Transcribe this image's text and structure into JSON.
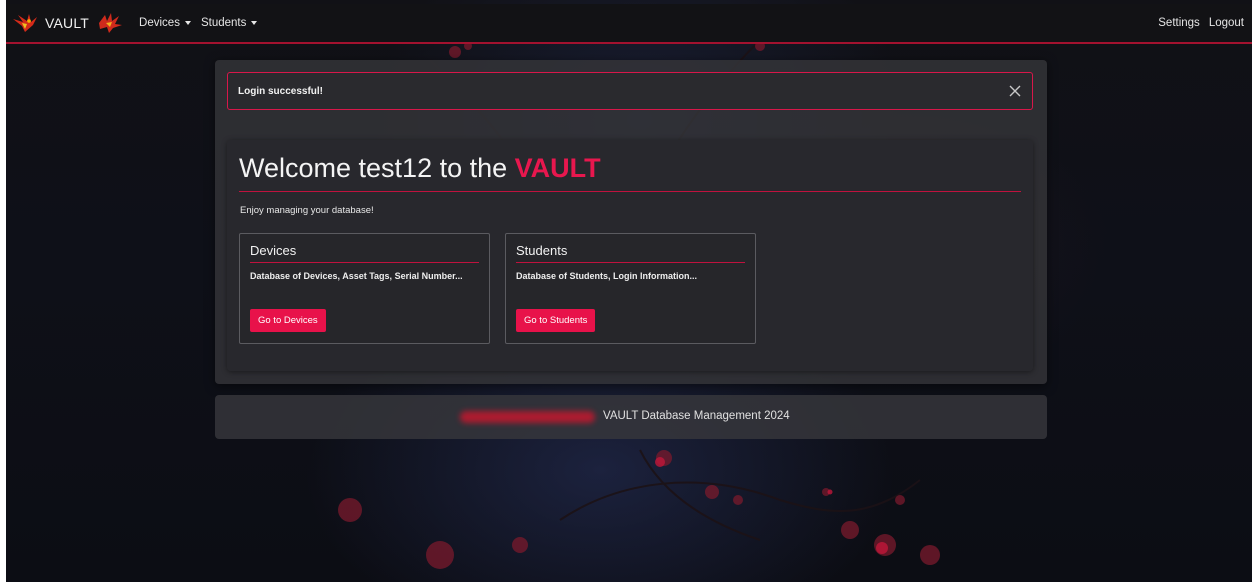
{
  "navbar": {
    "brand": "VAULT",
    "menu": [
      {
        "label": "Devices"
      },
      {
        "label": "Students"
      }
    ],
    "right_links": [
      {
        "label": "Settings"
      },
      {
        "label": "Logout"
      }
    ]
  },
  "alert": {
    "message": "Login successful!"
  },
  "welcome": {
    "title_prefix": "Welcome test12 to the",
    "title_highlight": "VAULT",
    "subtitle": "Enjoy managing your database!"
  },
  "cards": [
    {
      "title": "Devices",
      "description": "Database of Devices, Asset Tags, Serial Number...",
      "button_label": "Go to Devices"
    },
    {
      "title": "Students",
      "description": "Database of Students, Login Information...",
      "button_label": "Go to Students"
    }
  ],
  "footer": {
    "text": "VAULT Database Management 2024"
  },
  "colors": {
    "accent": "#e8124a",
    "navbar_border": "#a3122f",
    "background": "#0c0c10"
  }
}
